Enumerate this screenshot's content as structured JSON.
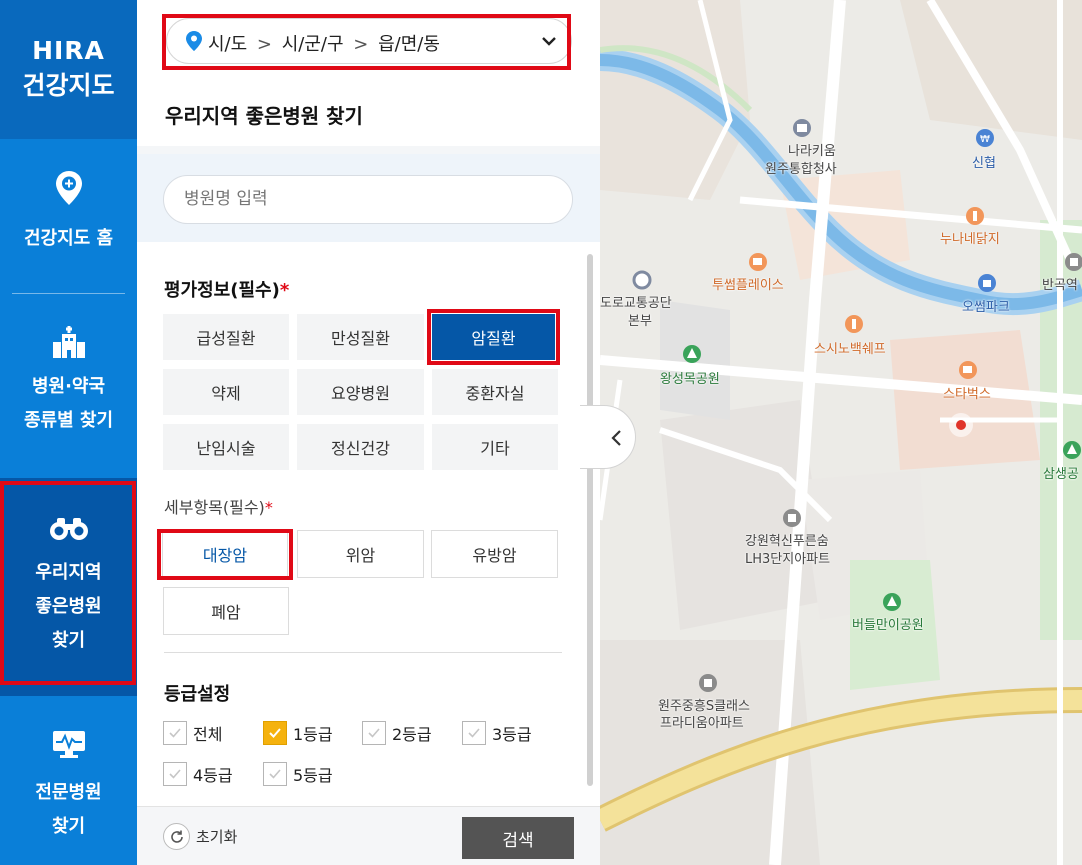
{
  "nav": {
    "logo_line1": "HIRA",
    "logo_line2": "건강지도",
    "items": [
      {
        "line1": "건강지도 홈",
        "line2": "",
        "line3": ""
      },
      {
        "line1": "병원·약국",
        "line2": "종류별 찾기",
        "line3": ""
      },
      {
        "line1": "우리지역",
        "line2": "좋은병원",
        "line3": "찾기"
      },
      {
        "line1": "전문병원",
        "line2": "찾기",
        "line3": ""
      }
    ]
  },
  "region": {
    "sido": "시/도",
    "sigungu": "시/군/구",
    "eupmyeondong": "읍/면/동",
    "sep": ">"
  },
  "panel": {
    "title": "우리지역 좋은병원 찾기",
    "search_placeholder": "병원명 입력",
    "eval_title": "평가정보(필수)",
    "detail_title": "세부항목(필수)",
    "grade_title": "등급설정",
    "required_mark": "*"
  },
  "eval_items": [
    "급성질환",
    "만성질환",
    "암질환",
    "약제",
    "요양병원",
    "중환자실",
    "난임시술",
    "정신건강",
    "기타"
  ],
  "eval_selected": "암질환",
  "detail_items": [
    "대장암",
    "위암",
    "유방암",
    "폐암"
  ],
  "detail_selected": "대장암",
  "grades": [
    {
      "label": "전체",
      "checked": false
    },
    {
      "label": "1등급",
      "checked": true
    },
    {
      "label": "2등급",
      "checked": false
    },
    {
      "label": "3등급",
      "checked": false
    },
    {
      "label": "4등급",
      "checked": false
    },
    {
      "label": "5등급",
      "checked": false
    }
  ],
  "footer": {
    "reset_label": "초기화",
    "search_label": "검색"
  },
  "map": {
    "labels": {
      "narakium": "나라키움",
      "wonju_gov": "원주통합청사",
      "shinhyup": "신협",
      "nuna": "누나네닭지",
      "twosome": "투썸플레이스",
      "road_traffic": "도로교통공단",
      "road_traffic2": "본부",
      "ossum": "오썸파크",
      "bangok": "반곡역",
      "sushi": "스시노백쉐프",
      "wangsung": "왕성목공원",
      "starbucks": "스타벅스",
      "samsaeng": "삼생공",
      "gangwon1": "강원혁신푸른숨",
      "gangwon2": "LH3단지아파트",
      "beodeul": "버들만이공원",
      "wonju_s1": "원주중흥S클래스",
      "wonju_s2": "프라디움아파트"
    }
  },
  "colors": {
    "nav_blue": "#0a7fd8",
    "nav_active": "#0557a7",
    "highlight_red": "#e00916",
    "checkbox_on": "#f5b20e"
  }
}
